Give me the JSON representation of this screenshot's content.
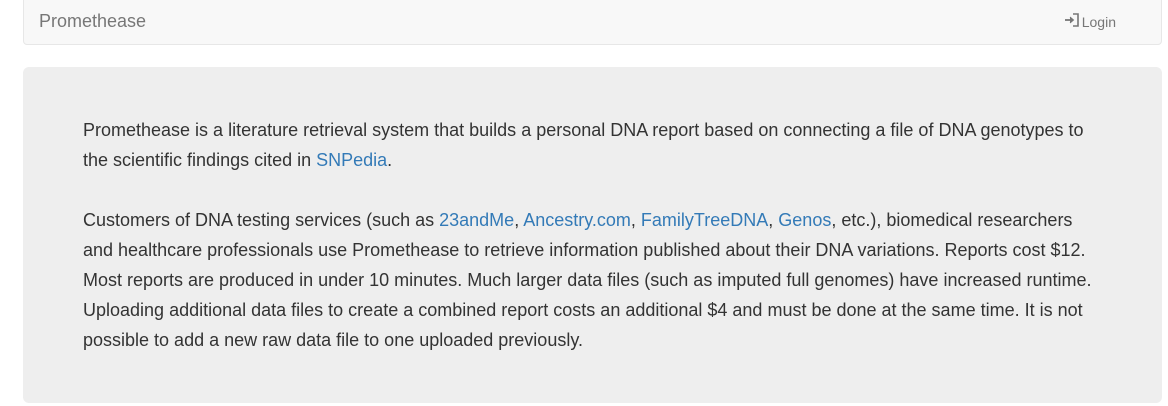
{
  "navbar": {
    "brand": "Promethease",
    "login_label": "Login",
    "login_icon": "log-in-icon"
  },
  "intro": {
    "text_before": "Promethease is a literature retrieval system that builds a personal DNA report based on connecting a file of DNA genotypes to the scientific findings cited in ",
    "snpedia_link": "SNPedia",
    "text_after": "."
  },
  "customers": {
    "text_start": "Customers of DNA testing services (such as ",
    "link_23andme": "23andMe",
    "sep1": ", ",
    "link_ancestry": "Ancestry.com",
    "sep2": ", ",
    "link_familytreedna": "FamilyTreeDNA",
    "sep3": ", ",
    "link_genos": "Genos",
    "text_end": ", etc.), biomedical researchers and healthcare professionals use Promethease to retrieve information published about their DNA variations. Reports cost $12. Most reports are produced in under 10 minutes. Much larger data files (such as imputed full genomes) have increased runtime. Uploading additional data files to create a combined report costs an additional $4 and must be done at the same time. It is not possible to add a new raw data file to one uploaded previously."
  },
  "colors": {
    "link": "#337ab7",
    "text": "#333333",
    "navbar_bg": "#f8f8f8",
    "jumbotron_bg": "#eeeeee"
  }
}
